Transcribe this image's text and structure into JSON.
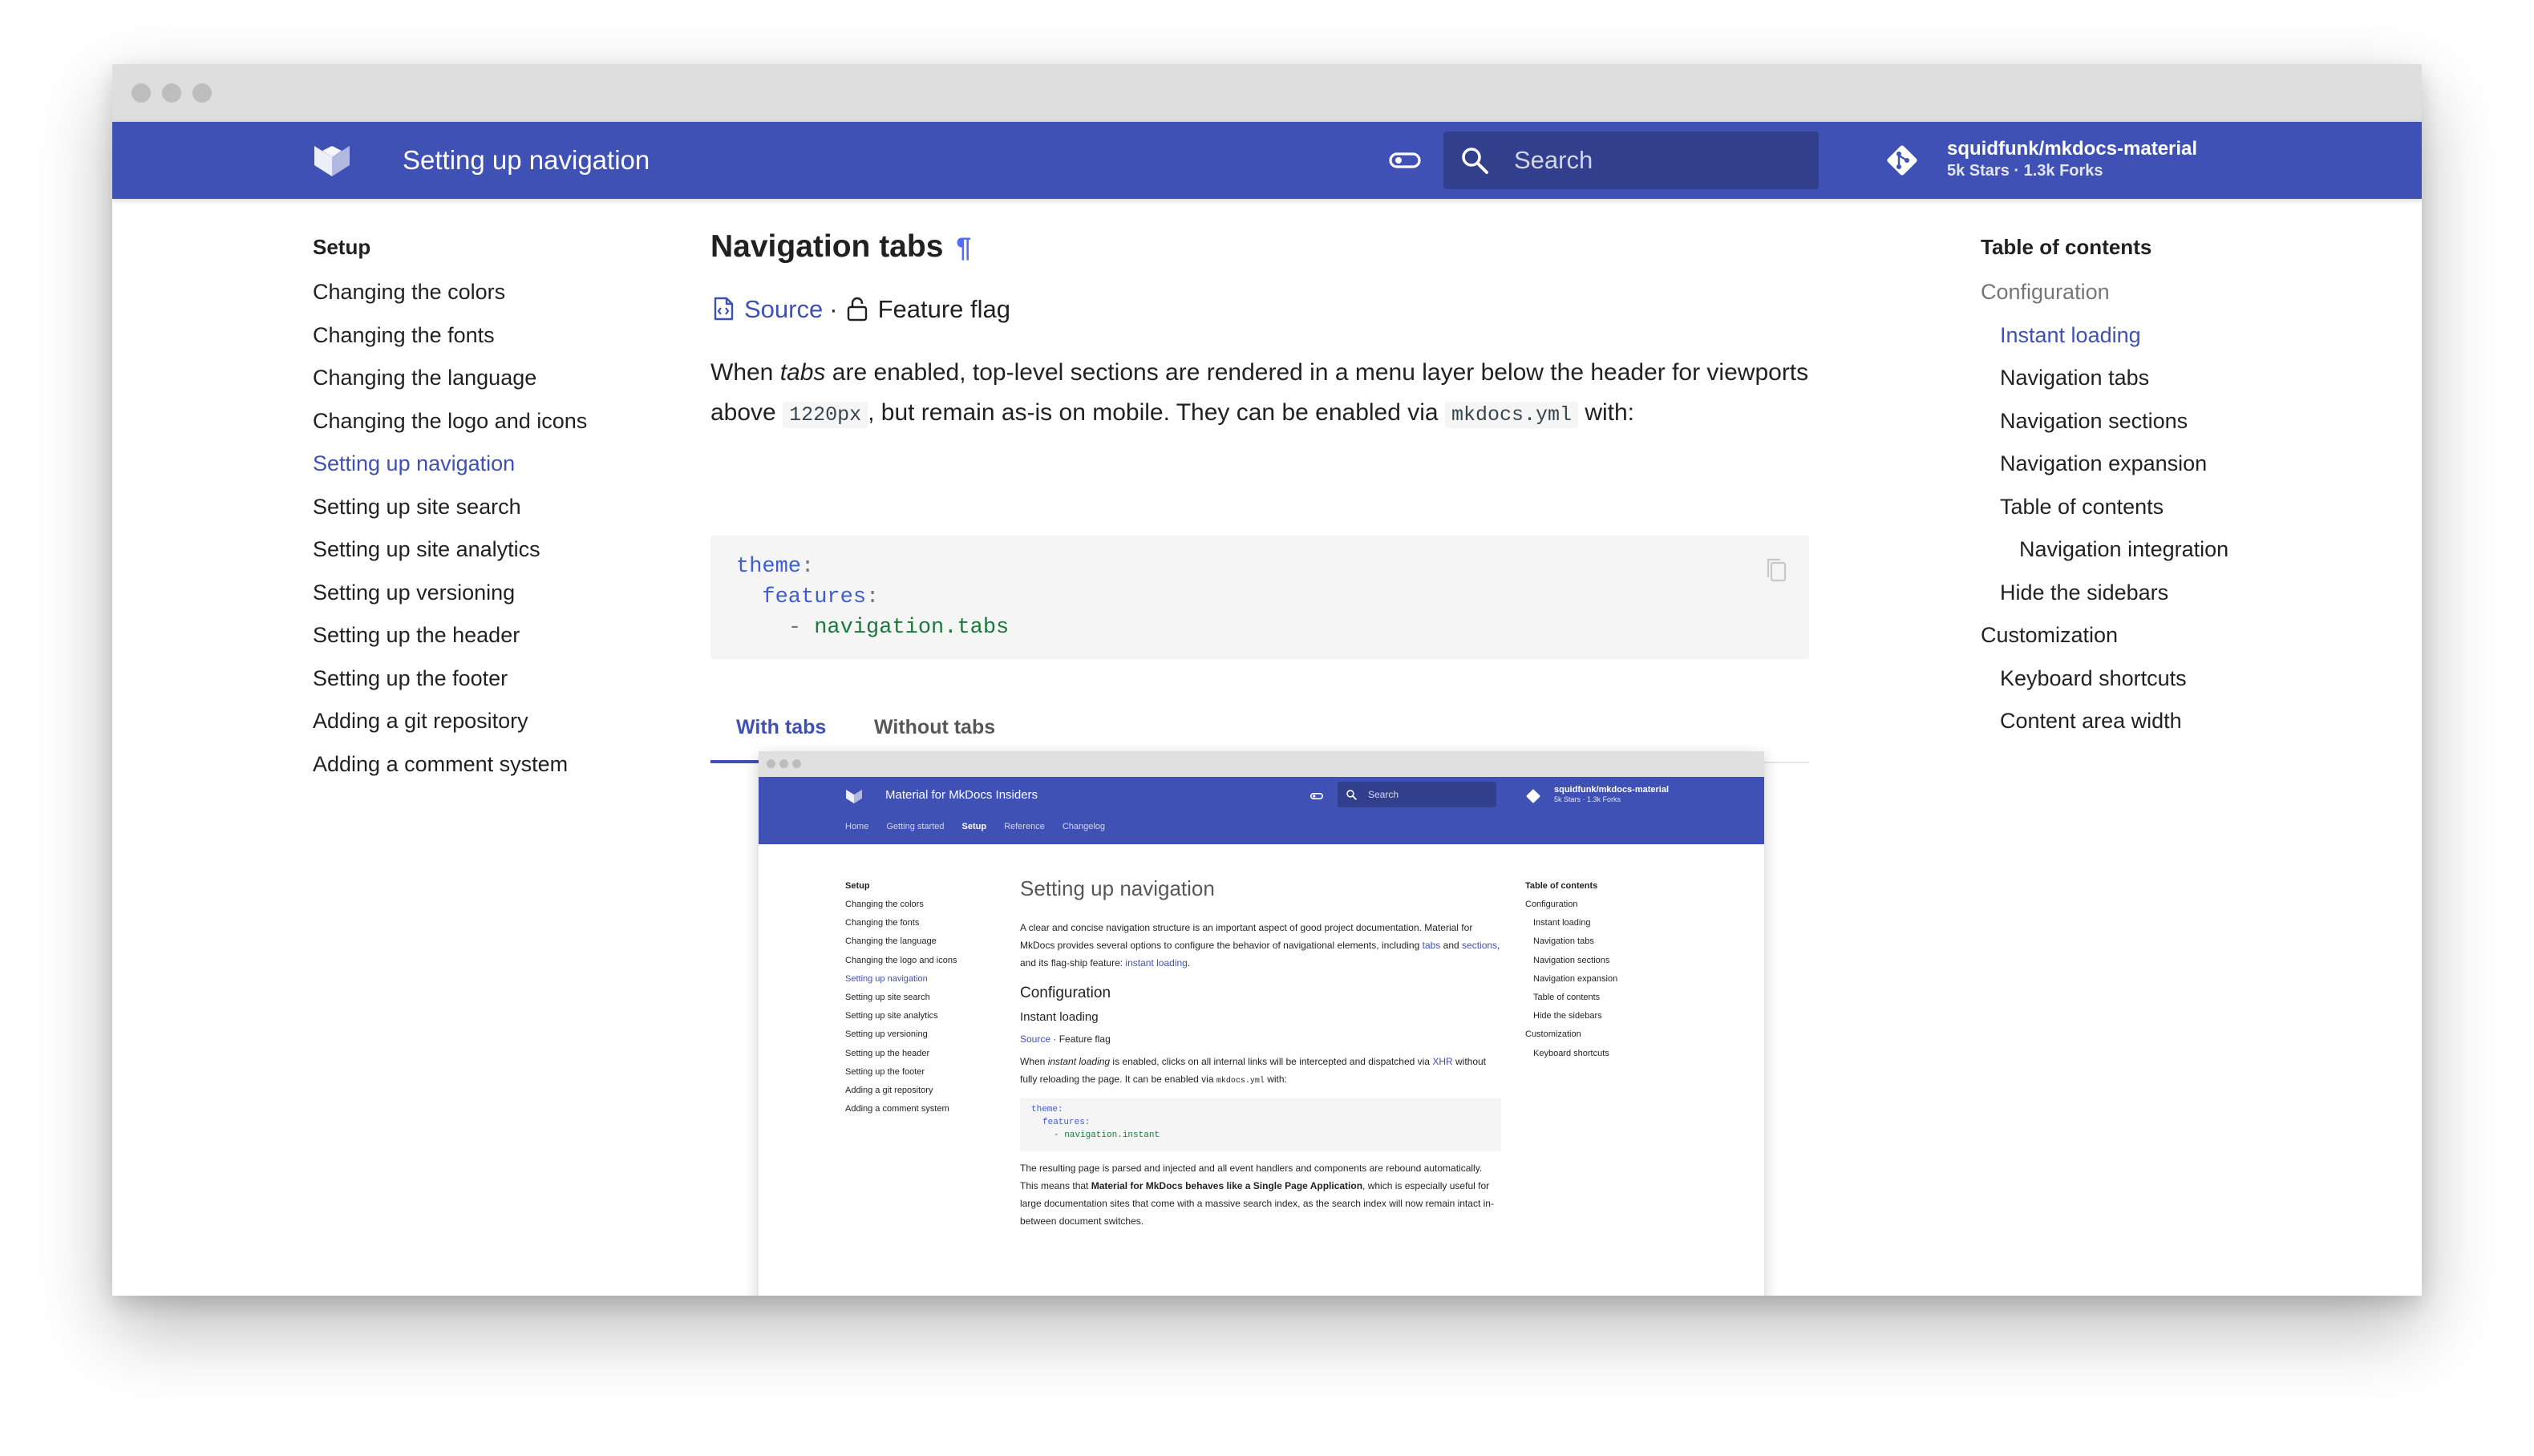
{
  "header": {
    "title": "Setting up navigation",
    "search_placeholder": "Search",
    "repo_name": "squidfunk/mkdocs-material",
    "repo_stats": "5k Stars · 1.3k Forks"
  },
  "nav": {
    "title": "Setup",
    "items": [
      {
        "label": "Changing the colors"
      },
      {
        "label": "Changing the fonts"
      },
      {
        "label": "Changing the language"
      },
      {
        "label": "Changing the logo and icons"
      },
      {
        "label": "Setting up navigation",
        "active": true
      },
      {
        "label": "Setting up site search"
      },
      {
        "label": "Setting up site analytics"
      },
      {
        "label": "Setting up versioning"
      },
      {
        "label": "Setting up the header"
      },
      {
        "label": "Setting up the footer"
      },
      {
        "label": "Adding a git repository"
      },
      {
        "label": "Adding a comment system"
      }
    ]
  },
  "content": {
    "heading": "Navigation tabs",
    "anchor": "¶",
    "source_label": "Source",
    "separator": "·",
    "flag_label": "Feature flag",
    "para_1": "When ",
    "para_em": "tabs",
    "para_2": " are enabled, top-level sections are rendered in a menu layer below the header for viewports above ",
    "para_code_1": "1220px",
    "para_3": ", but remain as-is on mobile. They can be enabled via ",
    "para_code_2": "mkdocs.yml",
    "para_4": " with:",
    "code": {
      "line1_key": "theme",
      "line2_key": "features",
      "line3_dash": "- ",
      "line3_val": "navigation.tabs",
      "colon": ":"
    },
    "tabs": [
      {
        "label": "With tabs",
        "active": true
      },
      {
        "label": "Without tabs"
      }
    ]
  },
  "inner": {
    "title": "Material for MkDocs Insiders",
    "search_label": "Search",
    "repo_name": "squidfunk/mkdocs-material",
    "repo_stats": "5k Stars · 1.3k Forks",
    "tabs": [
      "Home",
      "Getting started",
      "Setup",
      "Reference",
      "Changelog"
    ],
    "nav_title": "Setup",
    "nav_items": [
      "Changing the colors",
      "Changing the fonts",
      "Changing the language",
      "Changing the logo and icons",
      "Setting up navigation",
      "Setting up site search",
      "Setting up site analytics",
      "Setting up versioning",
      "Setting up the header",
      "Setting up the footer",
      "Adding a git repository",
      "Adding a comment system"
    ],
    "h1": "Setting up navigation",
    "intro_1": "A clear and concise navigation structure is an important aspect of good project documentation. Material for MkDocs provides several options to configure the behavior of navigational elements, including ",
    "intro_tabs": "tabs",
    "intro_and": " and ",
    "intro_sections": "sections",
    "intro_2": ", and its flag-ship feature: ",
    "intro_instant": "instant loading",
    "intro_3": ".",
    "h2": "Configuration",
    "h3": "Instant loading",
    "source_label": "Source",
    "flag_label": "Feature flag",
    "p2_1": "When ",
    "p2_em": "instant loading",
    "p2_2": " is enabled, clicks on all internal links will be intercepted and dispatched via ",
    "p2_xhr": "XHR",
    "p2_3": " without fully reloading the page. It can be enabled via ",
    "p2_code": "mkdocs.yml",
    "p2_4": " with:",
    "code_l1": "theme:",
    "code_l2": "features:",
    "code_l3": "- navigation.instant",
    "p3_1": "The resulting page is parsed and injected and all event handlers and components are rebound automatically. This means that ",
    "p3_bold": "Material for MkDocs behaves like a Single Page Application",
    "p3_2": ", which is especially useful for large documentation sites that come with a massive search index, as the search index will now remain intact in-between document switches.",
    "toc_title": "Table of contents",
    "toc_items": [
      {
        "label": "Configuration",
        "sub": false
      },
      {
        "label": "Instant loading",
        "sub": true
      },
      {
        "label": "Navigation tabs",
        "sub": true
      },
      {
        "label": "Navigation sections",
        "sub": true
      },
      {
        "label": "Navigation expansion",
        "sub": true
      },
      {
        "label": "Table of contents",
        "sub": true
      },
      {
        "label": "Hide the sidebars",
        "sub": true
      },
      {
        "label": "Customization",
        "sub": false
      },
      {
        "label": "Keyboard shortcuts",
        "sub": true
      }
    ]
  },
  "toc": {
    "title": "Table of contents",
    "items": [
      {
        "label": "Configuration",
        "level": 1,
        "dim": true
      },
      {
        "label": "Instant loading",
        "level": 2,
        "active": true
      },
      {
        "label": "Navigation tabs",
        "level": 2
      },
      {
        "label": "Navigation sections",
        "level": 2
      },
      {
        "label": "Navigation expansion",
        "level": 2
      },
      {
        "label": "Table of contents",
        "level": 2
      },
      {
        "label": "Navigation integration",
        "level": 3
      },
      {
        "label": "Hide the sidebars",
        "level": 2
      },
      {
        "label": "Customization",
        "level": 1
      },
      {
        "label": "Keyboard shortcuts",
        "level": 2
      },
      {
        "label": "Content area width",
        "level": 2
      }
    ]
  },
  "colors": {
    "primary": "#4051b5",
    "primary_dark": "#313f8d",
    "anchor": "#526cfe",
    "code_bg": "#f5f5f5"
  },
  "icons": {
    "logo": "material-logo-icon",
    "palette": "toggle-icon",
    "search": "search-icon",
    "repo": "git-icon",
    "source": "file-code-icon",
    "flag": "lock-open-icon",
    "copy": "copy-icon"
  }
}
